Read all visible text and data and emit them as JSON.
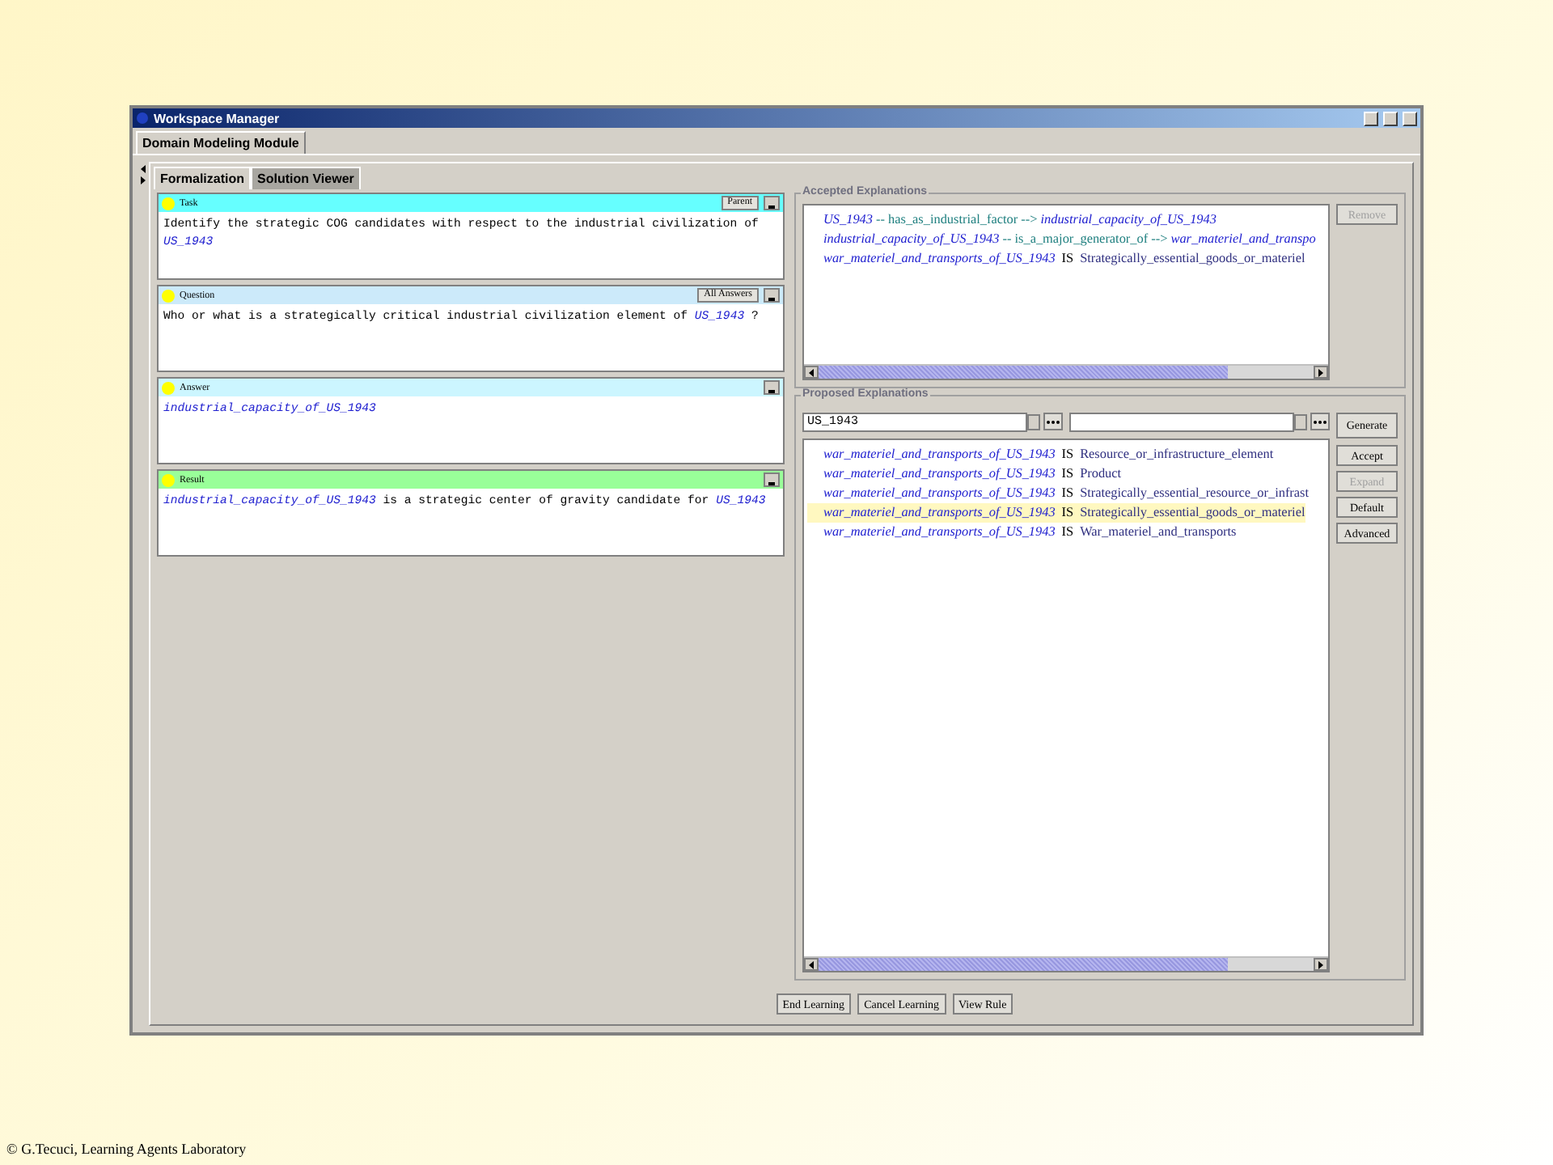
{
  "window": {
    "title": "Workspace Manager"
  },
  "module_tabs": [
    {
      "label": "Domain Modeling Module",
      "selected": true
    }
  ],
  "tabs": [
    {
      "label": "Formalization",
      "selected": true
    },
    {
      "label": "Solution Viewer",
      "selected": false
    }
  ],
  "panels": [
    {
      "title": "Task",
      "color": "#66ffff",
      "button": "Parent",
      "text": [
        {
          "kind": "plain",
          "text": "Identify the strategic COG candidates with respect to the industrial civilization of "
        },
        {
          "kind": "concept",
          "text": "US_1943"
        }
      ]
    },
    {
      "title": "Question",
      "color": "#cceafa",
      "button": "All Answers",
      "text": [
        {
          "kind": "plain",
          "text": "Who or what is a strategically critical industrial civilization element of "
        },
        {
          "kind": "concept",
          "text": "US_1943"
        },
        {
          "kind": "plain",
          "text": " ?"
        }
      ]
    },
    {
      "title": "Answer",
      "color": "#ccf6ff",
      "text": [
        {
          "kind": "concept",
          "text": "industrial_capacity_of_US_1943"
        }
      ]
    },
    {
      "title": "Result",
      "color": "#99ff99",
      "text": [
        {
          "kind": "concept",
          "text": "industrial_capacity_of_US_1943"
        },
        {
          "kind": "plain",
          "text": " is a strategic center of gravity candidate for "
        },
        {
          "kind": "concept",
          "text": "US_1943"
        }
      ]
    }
  ],
  "accepted": {
    "title": "Accepted Explanations",
    "button": {
      "label": "Remove",
      "disabled": true
    },
    "items": [
      [
        {
          "kind": "concept",
          "text": "US_1943"
        },
        {
          "kind": "relation",
          "text": " -- has_as_industrial_factor --> "
        },
        {
          "kind": "concept",
          "text": "industrial_capacity_of_US_1943"
        }
      ],
      [
        {
          "kind": "concept",
          "text": "industrial_capacity_of_US_1943"
        },
        {
          "kind": "relation",
          "text": " -- is_a_major_generator_of --> "
        },
        {
          "kind": "concept",
          "text": "war_materiel_and_transpo"
        }
      ],
      [
        {
          "kind": "concept",
          "text": "war_materiel_and_transports_of_US_1943"
        },
        {
          "kind": "keyword",
          "text": "IS"
        },
        {
          "kind": "class",
          "text": "Strategically_essential_goods_or_materiel"
        }
      ]
    ]
  },
  "proposed": {
    "title": "Proposed Explanations",
    "fields": [
      {
        "kind": "combo",
        "value": "US_1943"
      },
      {
        "kind": "combo"
      }
    ],
    "generate": "Generate",
    "items": [
      {
        "selected": false,
        "text": [
          {
            "kind": "concept",
            "text": "war_materiel_and_transports_of_US_1943"
          },
          {
            "kind": "keyword",
            "text": "IS"
          },
          {
            "kind": "class",
            "text": "Resource_or_infrastructure_element"
          }
        ]
      },
      {
        "selected": false,
        "text": [
          {
            "kind": "concept",
            "text": "war_materiel_and_transports_of_US_1943"
          },
          {
            "kind": "keyword",
            "text": "IS"
          },
          {
            "kind": "class",
            "text": "Product"
          }
        ]
      },
      {
        "selected": false,
        "text": [
          {
            "kind": "concept",
            "text": "war_materiel_and_transports_of_US_1943"
          },
          {
            "kind": "keyword",
            "text": "IS"
          },
          {
            "kind": "class",
            "text": "Strategically_essential_resource_or_infrast"
          }
        ]
      },
      {
        "selected": true,
        "text": [
          {
            "kind": "concept",
            "text": "war_materiel_and_transports_of_US_1943"
          },
          {
            "kind": "keyword",
            "text": "IS"
          },
          {
            "kind": "class",
            "text": "Strategically_essential_goods_or_materiel"
          }
        ]
      },
      {
        "selected": false,
        "text": [
          {
            "kind": "concept",
            "text": "war_materiel_and_transports_of_US_1943"
          },
          {
            "kind": "keyword",
            "text": "IS"
          },
          {
            "kind": "class",
            "text": "War_materiel_and_transports"
          }
        ]
      }
    ],
    "buttons": [
      {
        "label": "Accept",
        "disabled": false
      },
      {
        "label": "Expand",
        "disabled": true
      },
      {
        "label": "Default",
        "disabled": false
      },
      {
        "label": "Advanced",
        "disabled": false
      }
    ]
  },
  "footer_buttons": [
    "End Learning",
    "Cancel Learning",
    "View Rule"
  ],
  "credit": "© G.Tecuci, Learning Agents Laboratory"
}
